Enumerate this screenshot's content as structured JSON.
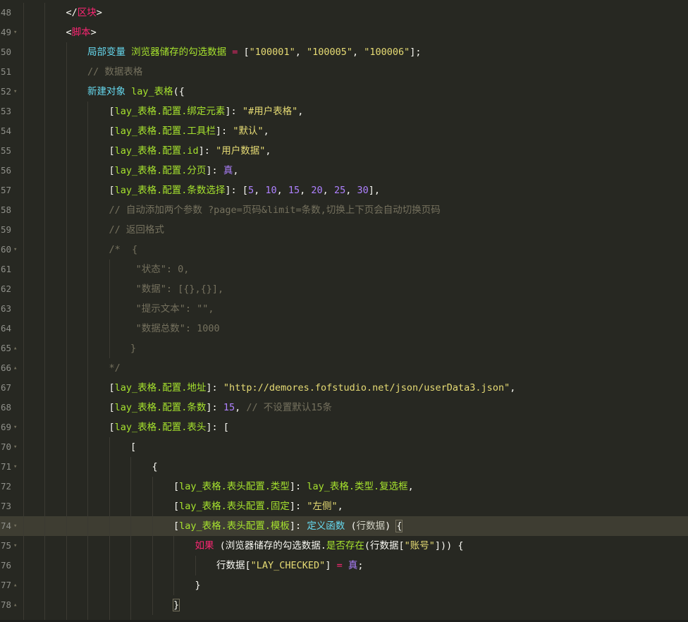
{
  "editor": {
    "active_line": "74",
    "lines": [
      {
        "no": "48",
        "fold": "",
        "indent": 3,
        "guides": [
          1,
          2
        ],
        "tokens": [
          {
            "t": "</",
            "c": "white"
          },
          {
            "t": "区块",
            "c": "pink"
          },
          {
            "t": ">",
            "c": "white"
          }
        ]
      },
      {
        "no": "49",
        "fold": "▾",
        "indent": 3,
        "guides": [
          1,
          2
        ],
        "tokens": [
          {
            "t": "<",
            "c": "white"
          },
          {
            "t": "脚本",
            "c": "pink"
          },
          {
            "t": ">",
            "c": "white"
          }
        ]
      },
      {
        "no": "50",
        "fold": "",
        "indent": 4,
        "guides": [
          1,
          2,
          3
        ],
        "tokens": [
          {
            "t": "局部变量 ",
            "c": "blue"
          },
          {
            "t": "浏览器储存的勾选数据",
            "c": "green"
          },
          {
            "t": " = ",
            "c": "pink"
          },
          {
            "t": "[",
            "c": "white"
          },
          {
            "t": "\"100001\"",
            "c": "yellow"
          },
          {
            "t": ", ",
            "c": "white"
          },
          {
            "t": "\"100005\"",
            "c": "yellow"
          },
          {
            "t": ", ",
            "c": "white"
          },
          {
            "t": "\"100006\"",
            "c": "yellow"
          },
          {
            "t": "];",
            "c": "white"
          }
        ]
      },
      {
        "no": "51",
        "fold": "",
        "indent": 4,
        "guides": [
          1,
          2,
          3
        ],
        "tokens": [
          {
            "t": "// 数据表格",
            "c": "gray"
          }
        ]
      },
      {
        "no": "52",
        "fold": "▾",
        "indent": 4,
        "guides": [
          1,
          2,
          3
        ],
        "tokens": [
          {
            "t": "新建对象 ",
            "c": "blue"
          },
          {
            "t": "lay_表格",
            "c": "green"
          },
          {
            "t": "({",
            "c": "white"
          }
        ]
      },
      {
        "no": "53",
        "fold": "",
        "indent": 5,
        "guides": [
          1,
          2,
          3,
          4
        ],
        "tokens": [
          {
            "t": "[",
            "c": "white"
          },
          {
            "t": "lay_表格.配置.绑定元素",
            "c": "green"
          },
          {
            "t": "]: ",
            "c": "white"
          },
          {
            "t": "\"#用户表格\"",
            "c": "yellow"
          },
          {
            "t": ",",
            "c": "white"
          }
        ]
      },
      {
        "no": "54",
        "fold": "",
        "indent": 5,
        "guides": [
          1,
          2,
          3,
          4
        ],
        "tokens": [
          {
            "t": "[",
            "c": "white"
          },
          {
            "t": "lay_表格.配置.工具栏",
            "c": "green"
          },
          {
            "t": "]: ",
            "c": "white"
          },
          {
            "t": "\"默认\"",
            "c": "yellow"
          },
          {
            "t": ",",
            "c": "white"
          }
        ]
      },
      {
        "no": "55",
        "fold": "",
        "indent": 5,
        "guides": [
          1,
          2,
          3,
          4
        ],
        "tokens": [
          {
            "t": "[",
            "c": "white"
          },
          {
            "t": "lay_表格.配置.id",
            "c": "green"
          },
          {
            "t": "]: ",
            "c": "white"
          },
          {
            "t": "\"用户数据\"",
            "c": "yellow"
          },
          {
            "t": ",",
            "c": "white"
          }
        ]
      },
      {
        "no": "56",
        "fold": "",
        "indent": 5,
        "guides": [
          1,
          2,
          3,
          4
        ],
        "tokens": [
          {
            "t": "[",
            "c": "white"
          },
          {
            "t": "lay_表格.配置.分页",
            "c": "green"
          },
          {
            "t": "]: ",
            "c": "white"
          },
          {
            "t": "真",
            "c": "purple"
          },
          {
            "t": ",",
            "c": "white"
          }
        ]
      },
      {
        "no": "57",
        "fold": "",
        "indent": 5,
        "guides": [
          1,
          2,
          3,
          4
        ],
        "tokens": [
          {
            "t": "[",
            "c": "white"
          },
          {
            "t": "lay_表格.配置.条数选择",
            "c": "green"
          },
          {
            "t": "]: [",
            "c": "white"
          },
          {
            "t": "5",
            "c": "purple"
          },
          {
            "t": ", ",
            "c": "white"
          },
          {
            "t": "10",
            "c": "purple"
          },
          {
            "t": ", ",
            "c": "white"
          },
          {
            "t": "15",
            "c": "purple"
          },
          {
            "t": ", ",
            "c": "white"
          },
          {
            "t": "20",
            "c": "purple"
          },
          {
            "t": ", ",
            "c": "white"
          },
          {
            "t": "25",
            "c": "purple"
          },
          {
            "t": ", ",
            "c": "white"
          },
          {
            "t": "30",
            "c": "purple"
          },
          {
            "t": "],",
            "c": "white"
          }
        ]
      },
      {
        "no": "58",
        "fold": "",
        "indent": 5,
        "guides": [
          1,
          2,
          3,
          4
        ],
        "tokens": [
          {
            "t": "// 自动添加两个参数 ?page=页码&limit=条数,切换上下页会自动切换页码",
            "c": "gray"
          }
        ]
      },
      {
        "no": "59",
        "fold": "",
        "indent": 5,
        "guides": [
          1,
          2,
          3,
          4
        ],
        "tokens": [
          {
            "t": "// 返回格式",
            "c": "gray"
          }
        ]
      },
      {
        "no": "60",
        "fold": "▾",
        "indent": 5,
        "guides": [
          1,
          2,
          3,
          4
        ],
        "tokens": [
          {
            "t": "/*  {",
            "c": "gray"
          }
        ]
      },
      {
        "no": "61",
        "fold": "",
        "indent": 6.25,
        "guides": [
          1,
          2,
          3,
          4,
          5
        ],
        "tokens": [
          {
            "t": "\"状态\": 0,",
            "c": "gray"
          }
        ]
      },
      {
        "no": "62",
        "fold": "",
        "indent": 6.25,
        "guides": [
          1,
          2,
          3,
          4,
          5
        ],
        "tokens": [
          {
            "t": "\"数据\": [{},{}],",
            "c": "gray"
          }
        ]
      },
      {
        "no": "63",
        "fold": "",
        "indent": 6.25,
        "guides": [
          1,
          2,
          3,
          4,
          5
        ],
        "tokens": [
          {
            "t": "\"提示文本\": \"\",",
            "c": "gray"
          }
        ]
      },
      {
        "no": "64",
        "fold": "",
        "indent": 6.25,
        "guides": [
          1,
          2,
          3,
          4,
          5
        ],
        "tokens": [
          {
            "t": "\"数据总数\": 1000",
            "c": "gray"
          }
        ]
      },
      {
        "no": "65",
        "fold": "▴",
        "indent": 6,
        "guides": [
          1,
          2,
          3,
          4,
          5
        ],
        "tokens": [
          {
            "t": "}",
            "c": "gray"
          }
        ]
      },
      {
        "no": "66",
        "fold": "▴",
        "indent": 5,
        "guides": [
          1,
          2,
          3,
          4
        ],
        "tokens": [
          {
            "t": "*/",
            "c": "gray"
          }
        ]
      },
      {
        "no": "67",
        "fold": "",
        "indent": 5,
        "guides": [
          1,
          2,
          3,
          4
        ],
        "tokens": [
          {
            "t": "[",
            "c": "white"
          },
          {
            "t": "lay_表格.配置.地址",
            "c": "green"
          },
          {
            "t": "]: ",
            "c": "white"
          },
          {
            "t": "\"http://demores.fofstudio.net/json/userData3.json\"",
            "c": "yellow"
          },
          {
            "t": ",",
            "c": "white"
          }
        ]
      },
      {
        "no": "68",
        "fold": "",
        "indent": 5,
        "guides": [
          1,
          2,
          3,
          4
        ],
        "tokens": [
          {
            "t": "[",
            "c": "white"
          },
          {
            "t": "lay_表格.配置.条数",
            "c": "green"
          },
          {
            "t": "]: ",
            "c": "white"
          },
          {
            "t": "15",
            "c": "purple"
          },
          {
            "t": ", ",
            "c": "white"
          },
          {
            "t": "// 不设置默认15条",
            "c": "gray"
          }
        ]
      },
      {
        "no": "69",
        "fold": "▾",
        "indent": 5,
        "guides": [
          1,
          2,
          3,
          4
        ],
        "tokens": [
          {
            "t": "[",
            "c": "white"
          },
          {
            "t": "lay_表格.配置.表头",
            "c": "green"
          },
          {
            "t": "]: [",
            "c": "white"
          }
        ]
      },
      {
        "no": "70",
        "fold": "▾",
        "indent": 6,
        "guides": [
          1,
          2,
          3,
          4,
          5
        ],
        "tokens": [
          {
            "t": "[",
            "c": "white"
          }
        ]
      },
      {
        "no": "71",
        "fold": "▾",
        "indent": 7,
        "guides": [
          1,
          2,
          3,
          4,
          5,
          6
        ],
        "tokens": [
          {
            "t": "{",
            "c": "white"
          }
        ]
      },
      {
        "no": "72",
        "fold": "",
        "indent": 8,
        "guides": [
          1,
          2,
          3,
          4,
          5,
          6,
          7
        ],
        "tokens": [
          {
            "t": "[",
            "c": "white"
          },
          {
            "t": "lay_表格.表头配置.类型",
            "c": "green"
          },
          {
            "t": "]: ",
            "c": "white"
          },
          {
            "t": "lay_表格.类型.复选框",
            "c": "green"
          },
          {
            "t": ",",
            "c": "white"
          }
        ]
      },
      {
        "no": "73",
        "fold": "",
        "indent": 8,
        "guides": [
          1,
          2,
          3,
          4,
          5,
          6,
          7
        ],
        "tokens": [
          {
            "t": "[",
            "c": "white"
          },
          {
            "t": "lay_表格.表头配置.固定",
            "c": "green"
          },
          {
            "t": "]: ",
            "c": "white"
          },
          {
            "t": "\"左侧\"",
            "c": "yellow"
          },
          {
            "t": ",",
            "c": "white"
          }
        ]
      },
      {
        "no": "74",
        "fold": "▾",
        "indent": 8,
        "guides": [
          1,
          2,
          3,
          4,
          5,
          6,
          7
        ],
        "tokens": [
          {
            "t": "[",
            "c": "white"
          },
          {
            "t": "lay_表格.表头配置.模板",
            "c": "green"
          },
          {
            "t": "]: ",
            "c": "white"
          },
          {
            "t": "定义函数",
            "c": "blue"
          },
          {
            "t": " (",
            "c": "white"
          },
          {
            "t": "行数据",
            "c": "white-dim"
          },
          {
            "t": ") ",
            "c": "white"
          },
          {
            "t": "{",
            "c": "white",
            "cursor": true
          }
        ]
      },
      {
        "no": "75",
        "fold": "▾",
        "indent": 9,
        "guides": [
          1,
          2,
          3,
          4,
          5,
          6,
          7,
          8
        ],
        "tokens": [
          {
            "t": "如果",
            "c": "pink"
          },
          {
            "t": " (浏览器储存的勾选数据.",
            "c": "white"
          },
          {
            "t": "是否存在",
            "c": "green"
          },
          {
            "t": "(行数据[",
            "c": "white"
          },
          {
            "t": "\"账号\"",
            "c": "yellow"
          },
          {
            "t": "])) {",
            "c": "white"
          }
        ]
      },
      {
        "no": "76",
        "fold": "",
        "indent": 10,
        "guides": [
          1,
          2,
          3,
          4,
          5,
          6,
          7,
          8,
          9
        ],
        "tokens": [
          {
            "t": "行数据[",
            "c": "white"
          },
          {
            "t": "\"LAY_CHECKED\"",
            "c": "yellow"
          },
          {
            "t": "] ",
            "c": "white"
          },
          {
            "t": "=",
            "c": "pink"
          },
          {
            "t": " ",
            "c": "white"
          },
          {
            "t": "真",
            "c": "purple"
          },
          {
            "t": ";",
            "c": "white"
          }
        ]
      },
      {
        "no": "77",
        "fold": "▴",
        "indent": 9,
        "guides": [
          1,
          2,
          3,
          4,
          5,
          6,
          7,
          8
        ],
        "tokens": [
          {
            "t": "}",
            "c": "white"
          }
        ]
      },
      {
        "no": "78",
        "fold": "▴",
        "indent": 8,
        "guides": [
          1,
          2,
          3,
          4,
          5,
          6,
          7
        ],
        "tokens": [
          {
            "t": "}",
            "c": "white",
            "cursor": true
          }
        ]
      },
      {
        "no": "",
        "fold": "",
        "indent": 7,
        "guides": [
          1,
          2,
          3,
          4,
          5,
          6
        ],
        "tokens": [
          {
            "t": "},",
            "c": "white"
          }
        ]
      }
    ]
  }
}
